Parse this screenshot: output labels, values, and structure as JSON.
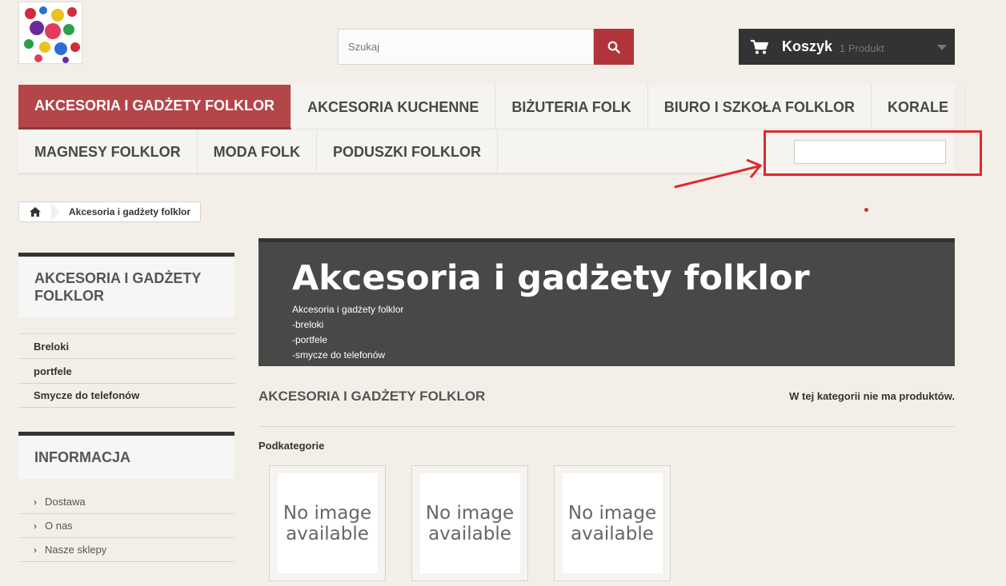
{
  "header": {
    "search_placeholder": "Szukaj",
    "cart_title": "Koszyk",
    "cart_count": "1 Produkt"
  },
  "menu": {
    "row1": [
      "AKCESORIA I GADŻETY FOLKLOR",
      "AKCESORIA KUCHENNE",
      "BIŻUTERIA FOLK",
      "BIURO I SZKOŁA FOLKLOR",
      "KORALE"
    ],
    "row2": [
      "MAGNESY FOLKLOR",
      "MODA FOLK",
      "PODUSZKI FOLKLOR"
    ]
  },
  "breadcrumb": {
    "current": "Akcesoria i gadżety folklor"
  },
  "sidebar": {
    "category_title": "AKCESORIA I GADŻETY FOLKLOR",
    "categories": [
      "Breloki",
      "portfele",
      "Smycze do telefonów"
    ],
    "info_title": "INFORMACJA",
    "info_links": [
      "Dostawa",
      "O nas",
      "Nasze sklepy"
    ]
  },
  "banner": {
    "title": "Akcesoria i gadżety folklor",
    "lines": [
      "Akcesoria i gadżety folklor",
      "-breloki",
      "-portfele",
      "-smycze do telefonów"
    ]
  },
  "content": {
    "heading": "AKCESORIA I GADŻETY FOLKLOR",
    "no_products": "W tej kategorii nie ma produktów.",
    "subcategories_title": "Podkategorie",
    "no_image_text": "No image available"
  },
  "colors": {
    "accent": "#b1343b",
    "annotation": "#e3262e",
    "dark": "#333333"
  }
}
